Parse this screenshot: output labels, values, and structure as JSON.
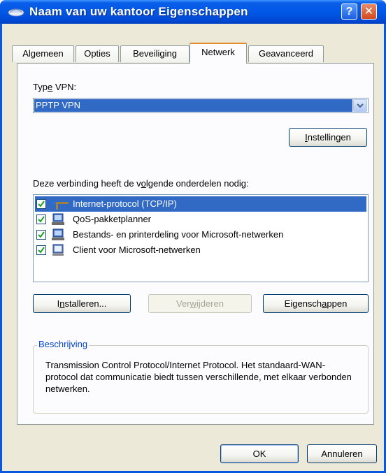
{
  "window": {
    "title": "Naam van uw kantoor Eigenschappen",
    "help_glyph": "?",
    "close_glyph": "✕"
  },
  "tabs": [
    {
      "label": "Algemeen"
    },
    {
      "label": "Opties"
    },
    {
      "label": "Beveiliging"
    },
    {
      "label": "Netwerk"
    },
    {
      "label": "Geavanceerd"
    }
  ],
  "active_tab": "Netwerk",
  "vpn": {
    "type_label_pre": "Typ",
    "type_label_acc": "e",
    "type_label_post": " VPN:",
    "selected": "PPTP VPN"
  },
  "settings_button": {
    "acc": "I",
    "rest": "nstellingen"
  },
  "components": {
    "label_pre": "Deze verbinding heeft de v",
    "label_acc": "o",
    "label_post": "lgende onderdelen nodig:",
    "items": [
      {
        "label": "Internet-protocol (TCP/IP)",
        "checked": true,
        "selected": true,
        "icon": "protocol-icon"
      },
      {
        "label": "QoS-pakketplanner",
        "checked": true,
        "selected": false,
        "icon": "network-service-icon"
      },
      {
        "label": "Bestands- en printerdeling voor Microsoft-netwerken",
        "checked": true,
        "selected": false,
        "icon": "network-service-icon"
      },
      {
        "label": "Client voor Microsoft-netwerken",
        "checked": true,
        "selected": false,
        "icon": "network-client-icon"
      }
    ]
  },
  "buttons": {
    "install": {
      "pre": "I",
      "acc": "n",
      "post": "stalleren..."
    },
    "remove": {
      "pre": "Ver",
      "acc": "w",
      "post": "ijderen"
    },
    "properties": {
      "pre": "Eigensch",
      "acc": "a",
      "post": "ppen"
    },
    "ok": "OK",
    "cancel": "Annuleren"
  },
  "description": {
    "title": "Beschrijving",
    "text": "Transmission Control Protocol/Internet Protocol. Het standaard-WAN-protocol dat communicatie biedt tussen verschillende, met elkaar verbonden netwerken."
  },
  "colors": {
    "titlebar": "#0058e6",
    "selection": "#316ac5",
    "active_tab_accent": "#e68b2c",
    "group_title": "#0046d5"
  }
}
